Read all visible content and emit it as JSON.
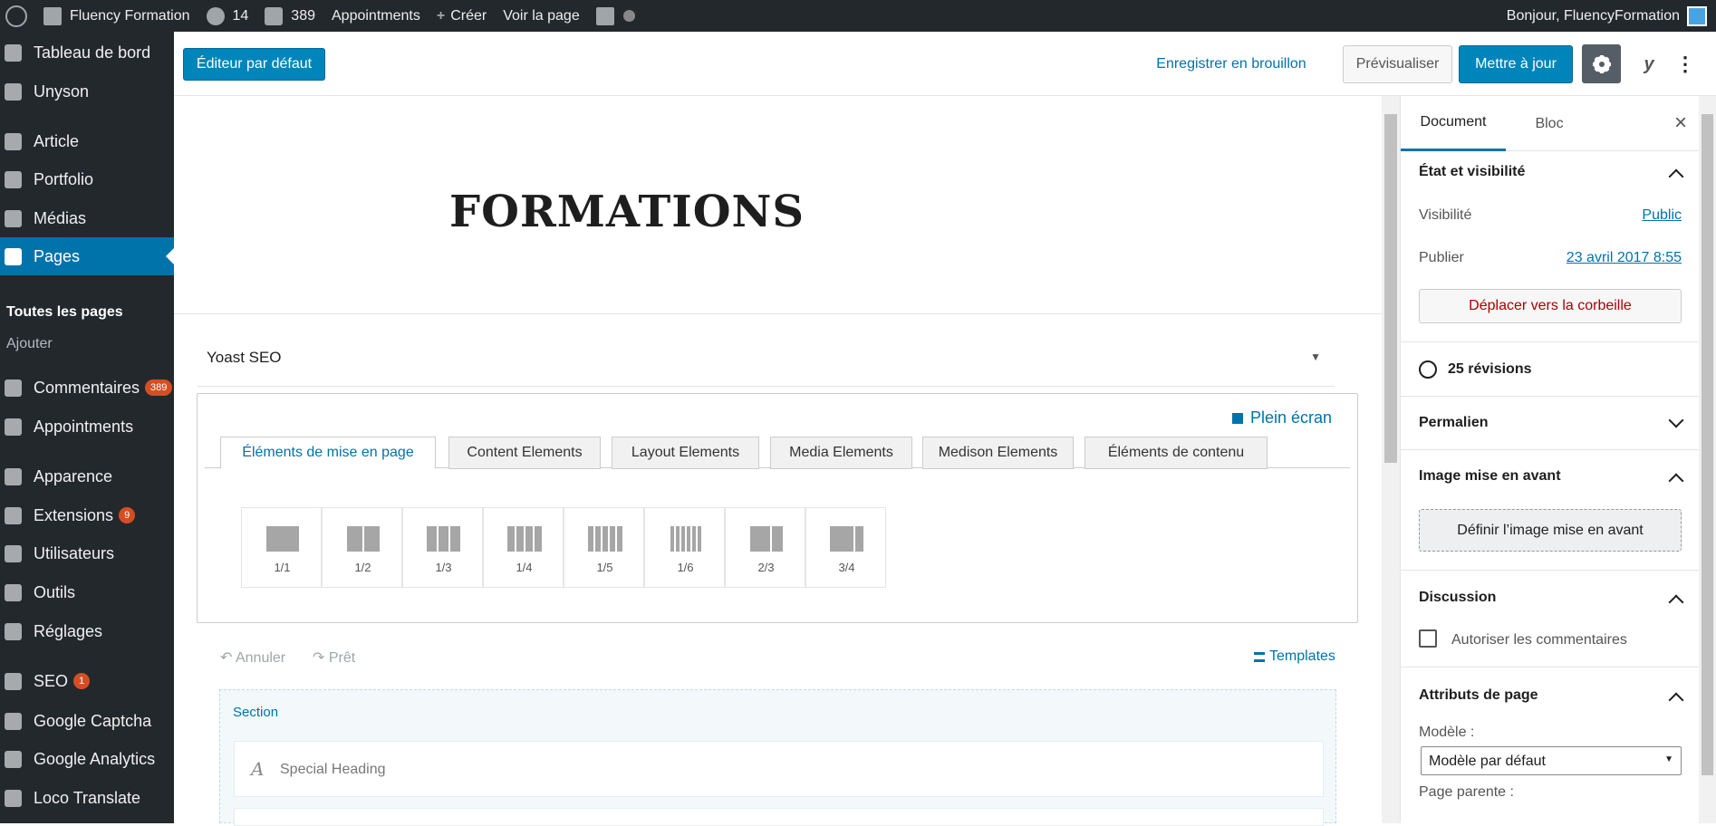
{
  "adminbar": {
    "site_name": "Fluency Formation",
    "updates_count": "14",
    "comments_count": "389",
    "appointments": "Appointments",
    "create": "Créer",
    "view_page": "Voir la page",
    "greeting": "Bonjour, FluencyFormation"
  },
  "sidebar": {
    "items": [
      {
        "label": "Tableau de bord",
        "icon": "dashboard-icon"
      },
      {
        "label": "Unyson",
        "icon": "unyson-icon"
      },
      {
        "label": "Article",
        "icon": "pin-icon"
      },
      {
        "label": "Portfolio",
        "icon": "folder-icon"
      },
      {
        "label": "Médias",
        "icon": "media-icon"
      },
      {
        "label": "Pages",
        "icon": "pages-icon"
      },
      {
        "label": "Commentaires",
        "icon": "comment-icon",
        "badge": "389"
      },
      {
        "label": "Appointments",
        "icon": "calendar-icon"
      },
      {
        "label": "Apparence",
        "icon": "brush-icon"
      },
      {
        "label": "Extensions",
        "icon": "plugin-icon",
        "badge": "9"
      },
      {
        "label": "Utilisateurs",
        "icon": "user-icon"
      },
      {
        "label": "Outils",
        "icon": "wrench-icon"
      },
      {
        "label": "Réglages",
        "icon": "settings-icon"
      },
      {
        "label": "SEO",
        "icon": "yoast-icon",
        "badge": "1"
      },
      {
        "label": "Google Captcha",
        "icon": "captcha-icon"
      },
      {
        "label": "Google Analytics",
        "icon": "analytics-icon"
      },
      {
        "label": "Loco Translate",
        "icon": "translate-icon"
      }
    ],
    "submenu": {
      "all_pages": "Toutes les pages",
      "add": "Ajouter"
    }
  },
  "toolbar": {
    "default_editor": "Éditeur par défaut",
    "save_draft": "Enregistrer en brouillon",
    "preview": "Prévisualiser",
    "update": "Mettre à jour"
  },
  "editor": {
    "title": "FORMATIONS",
    "yoast": "Yoast SEO",
    "fullscreen": "Plein écran",
    "tabs": [
      "Éléments de mise en page",
      "Content Elements",
      "Layout Elements",
      "Media Elements",
      "Medison Elements",
      "Éléments de contenu"
    ],
    "layouts": [
      "1/1",
      "1/2",
      "1/3",
      "1/4",
      "1/5",
      "1/6",
      "2/3",
      "3/4"
    ],
    "undo": "Annuler",
    "redo": "Prêt",
    "templates": "Templates",
    "section": "Section",
    "special_heading": "Special Heading"
  },
  "panel": {
    "tabs": {
      "document": "Document",
      "block": "Bloc"
    },
    "status": {
      "title": "État et visibilité",
      "visibility_label": "Visibilité",
      "visibility_value": "Public",
      "publish_label": "Publier",
      "publish_value": "23 avril 2017 8:55",
      "trash": "Déplacer vers la corbeille"
    },
    "revisions": "25 révisions",
    "permalink": "Permalien",
    "featured": {
      "title": "Image mise en avant",
      "button": "Définir l’image mise en avant"
    },
    "discussion": {
      "title": "Discussion",
      "allow_comments": "Autoriser les commentaires"
    },
    "attributes": {
      "title": "Attributs de page",
      "template_label": "Modèle :",
      "template_value": "Modèle par défaut",
      "parent_label": "Page parente :"
    }
  }
}
